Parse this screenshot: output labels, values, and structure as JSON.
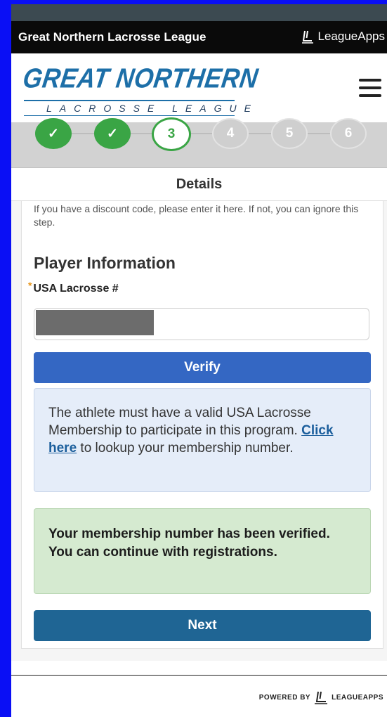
{
  "league_bar": {
    "league_name": "Great Northern Lacrosse League",
    "leagueapps_label": "LeagueApps"
  },
  "header": {
    "logo_title": "GREAT NORTHERN",
    "logo_subtitle": "LACROSSE LEAGUE",
    "menu_icon": "hamburger-menu-icon"
  },
  "stepper": {
    "steps": [
      {
        "label": "✓",
        "state": "completed"
      },
      {
        "label": "✓",
        "state": "completed"
      },
      {
        "label": "3",
        "state": "current"
      },
      {
        "label": "4",
        "state": "upcoming"
      },
      {
        "label": "5",
        "state": "upcoming"
      },
      {
        "label": "6",
        "state": "upcoming"
      }
    ]
  },
  "details_title": "Details",
  "form": {
    "discount_text": "If you have a discount code, please enter it here. If not, you can ignore this step.",
    "section_title": "Player Information",
    "required_marker": "*",
    "usa_label": "USA Lacrosse #",
    "usa_value": "",
    "verify_label": "Verify",
    "info_text_before": "The athlete must have a valid USA Lacrosse Membership to participate in this program.",
    "info_link": "Click here",
    "info_text_after": " to lookup your membership number.",
    "success_text": "Your membership number has been verified. You can continue with registrations.",
    "next_label": "Next"
  },
  "footer": {
    "powered_by": "POWERED BY",
    "brand": "LEAGUEAPPS"
  },
  "colors": {
    "accent_blue": "#3467c3",
    "next_blue": "#1f6594",
    "success_green": "#3aa545",
    "logo_blue": "#1d6fa8"
  }
}
